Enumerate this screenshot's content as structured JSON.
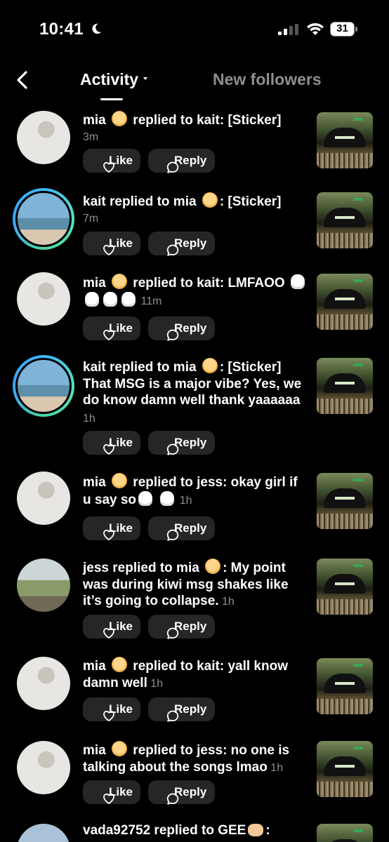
{
  "status_bar": {
    "time": "10:41",
    "battery": "31"
  },
  "header": {
    "tab_activity": "Activity",
    "tab_followers": "New followers"
  },
  "buttons": {
    "like": "Like",
    "reply": "Reply"
  },
  "items": [
    {
      "parts": [
        "mia ",
        "baby",
        " replied to kait: [Sticker]"
      ],
      "meta": "3m",
      "avatar": "mia"
    },
    {
      "parts": [
        "kait replied to mia ",
        "baby",
        ": [Sticker]"
      ],
      "meta": "7m",
      "avatar": "kait"
    },
    {
      "parts": [
        "mia ",
        "baby",
        " replied to kait: LMFAOO ",
        "skull",
        "skull",
        "skull",
        "skull"
      ],
      "meta": "11m",
      "avatar": "mia"
    },
    {
      "parts": [
        "kait replied to mia ",
        "baby",
        ": [Sticker] That MSG is a major vibe? Yes, we do know damn well thank yaaaaaa"
      ],
      "meta": "1h",
      "avatar": "kait"
    },
    {
      "parts": [
        "mia ",
        "baby",
        " replied to jess: okay girl if u say so",
        "skull",
        " ",
        "skull"
      ],
      "meta": "1h",
      "avatar": "mia"
    },
    {
      "parts": [
        "jess replied to mia ",
        "baby",
        ": My point was during kiwi msg shakes like it’s going to collapse."
      ],
      "meta": "1h",
      "avatar": "jess"
    },
    {
      "parts": [
        "mia ",
        "baby",
        " replied to kait: yall know damn well"
      ],
      "meta": "1h",
      "avatar": "mia"
    },
    {
      "parts": [
        "mia ",
        "baby",
        " replied to jess: no one is talking about the songs lmao"
      ],
      "meta": "1h",
      "avatar": "mia"
    },
    {
      "parts": [
        "vada92752 replied to GEE",
        "heart",
        ":"
      ],
      "meta": "",
      "avatar": "vada"
    }
  ]
}
